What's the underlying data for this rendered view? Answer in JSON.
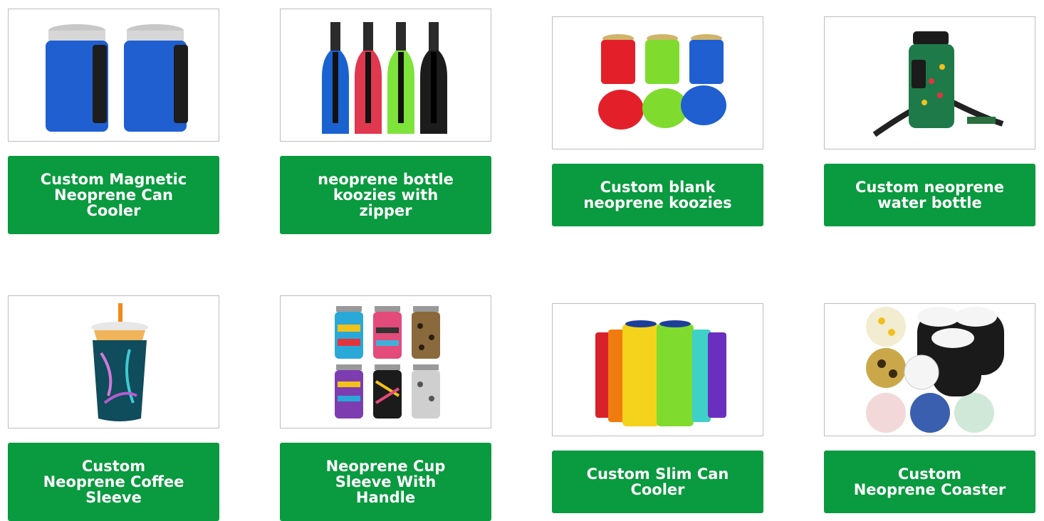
{
  "products": [
    {
      "title": "Custom Magnetic\nNeoprene Can\nCooler",
      "image": "magnetic-can-cooler-image"
    },
    {
      "title": "neoprene bottle\nkoozies with\nzipper",
      "image": "bottle-koozie-zipper-image"
    },
    {
      "title": "Custom blank\nneoprene koozies",
      "image": "blank-koozies-image"
    },
    {
      "title": "Custom neoprene\nwater bottle",
      "image": "water-bottle-bag-image"
    },
    {
      "title": "Custom\nNeoprene Coffee\nSleeve",
      "image": "coffee-sleeve-image"
    },
    {
      "title": "Neoprene Cup\nSleeve With\nHandle",
      "image": "cup-sleeve-handle-image"
    },
    {
      "title": "Custom Slim Can\nCooler",
      "image": "slim-can-cooler-image"
    },
    {
      "title": "Custom\nNeoprene Coaster",
      "image": "neoprene-coaster-image"
    }
  ],
  "colors": {
    "button_bg": "#0a9a3f",
    "button_text": "#ffffff",
    "border": "#bdbdbd"
  }
}
